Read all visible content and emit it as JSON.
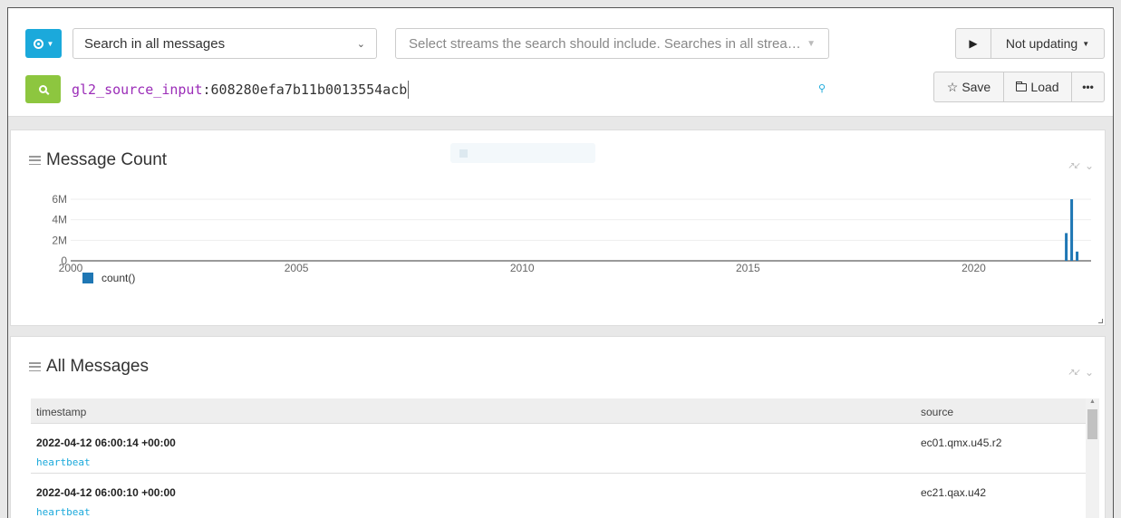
{
  "search": {
    "type_label": "Search in all messages",
    "streams_placeholder": "Select streams the search should include. Searches in all strea…",
    "refresh_status": "Not updating",
    "query_field": "gl2_source_input",
    "query_value": ":608280efa7b11b0013554acb",
    "save_label": "Save",
    "load_label": "Load",
    "more_label": "•••"
  },
  "widgets": {
    "message_count": {
      "title": "Message Count"
    },
    "all_messages": {
      "title": "All Messages"
    }
  },
  "chart_data": {
    "type": "bar",
    "xlim": [
      2000,
      2022.6
    ],
    "ylim": [
      0,
      6000000
    ],
    "x_ticks": [
      2000,
      2005,
      2010,
      2015,
      2020
    ],
    "y_ticks": [
      {
        "value": 0,
        "label": "0"
      },
      {
        "value": 2000000,
        "label": "2M"
      },
      {
        "value": 4000000,
        "label": "4M"
      },
      {
        "value": 6000000,
        "label": "6M"
      }
    ],
    "series": [
      {
        "name": "count()",
        "color": "#1f77b4",
        "points": [
          {
            "x": 2022.05,
            "y": 2700000
          },
          {
            "x": 2022.17,
            "y": 6000000
          },
          {
            "x": 2022.29,
            "y": 900000
          }
        ]
      }
    ],
    "grid": true,
    "legend": "bottom-left"
  },
  "table": {
    "columns": [
      "timestamp",
      "source"
    ],
    "rows": [
      {
        "timestamp": "2022-04-12 06:00:14 +00:00",
        "message": "heartbeat",
        "source": "ec01.qmx.u45.r2"
      },
      {
        "timestamp": "2022-04-12 06:00:10 +00:00",
        "message": "heartbeat",
        "source": "ec21.qax.u42"
      }
    ]
  }
}
